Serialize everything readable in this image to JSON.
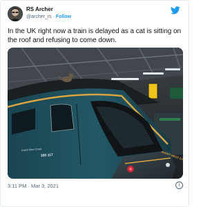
{
  "tweet": {
    "author_name": "RS Archer",
    "handle": "@archer_rs",
    "separator": "·",
    "follow_label": "Follow",
    "text": "In the UK right now a train is delayed as a cat is sitting on the roof and refusing to come down.",
    "timestamp": "3:11 PM · Mar 3, 2021",
    "info_icon": "i"
  },
  "photo": {
    "train_side_text": "Avanti West Coast",
    "train_number": "390 117",
    "train_nose_text": "AVANTI WEST COAST"
  },
  "icons": {
    "brand": "twitter-bird-icon",
    "info": "info-icon"
  },
  "colors": {
    "accent": "#1d9bf0",
    "secondary_text": "#536471",
    "train_teal": "#1f4e5a",
    "train_stripe": "#d9a441"
  }
}
